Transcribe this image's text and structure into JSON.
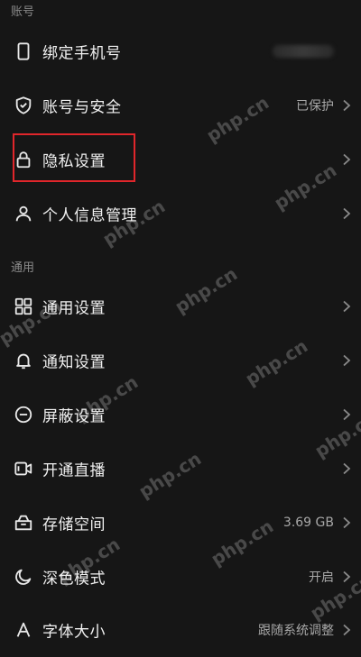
{
  "sections": {
    "account": "账号",
    "general": "通用"
  },
  "rows": {
    "bind_phone": {
      "label": "绑定手机号"
    },
    "account_security": {
      "label": "账号与安全",
      "value": "已保护"
    },
    "privacy": {
      "label": "隐私设置"
    },
    "personal_info": {
      "label": "个人信息管理"
    },
    "general_settings": {
      "label": "通用设置"
    },
    "notification": {
      "label": "通知设置"
    },
    "block": {
      "label": "屏蔽设置"
    },
    "live": {
      "label": "开通直播"
    },
    "storage": {
      "label": "存储空间",
      "value": "3.69 GB"
    },
    "dark_mode": {
      "label": "深色模式",
      "value": "开启"
    },
    "font_size": {
      "label": "字体大小",
      "value": "跟随系统调整"
    }
  },
  "watermark": "php.cn",
  "colors": {
    "background": "#161616",
    "highlight": "#e0262b"
  }
}
